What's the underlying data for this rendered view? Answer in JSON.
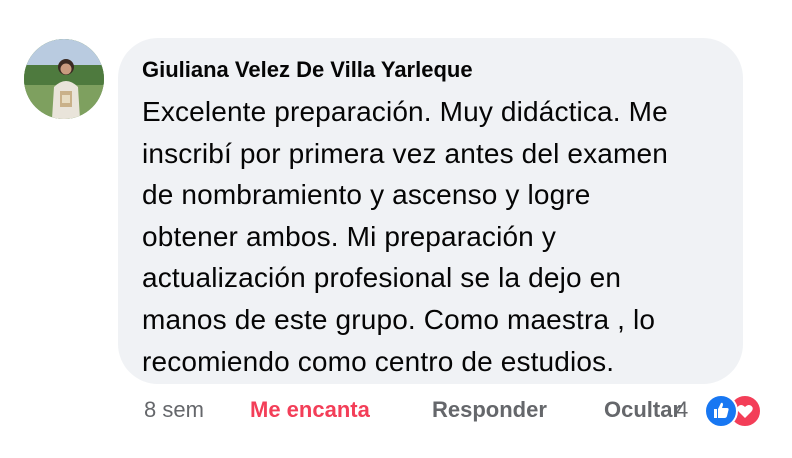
{
  "comment": {
    "author": "Giuliana Velez De Villa Yarleque",
    "lines": [
      "Excelente preparación. Muy didáctica. Me",
      "inscribí por primera vez antes del examen",
      "de nombramiento y ascenso y logre",
      "obtener ambos. Mi preparación y",
      "actualización profesional se la dejo en",
      "manos de este grupo. Como maestra , lo",
      "recomiendo como centro de estudios."
    ]
  },
  "actions": {
    "time": "8 sem",
    "love": "Me encanta",
    "reply": "Responder",
    "hide": "Ocultar",
    "reaction_count": "4"
  },
  "colors": {
    "bubble": "#f0f2f5",
    "love": "#f33e58",
    "like": "#1877f2",
    "meta": "#65676b"
  },
  "icons": {
    "like": "thumbs-up-icon",
    "love": "heart-icon"
  }
}
